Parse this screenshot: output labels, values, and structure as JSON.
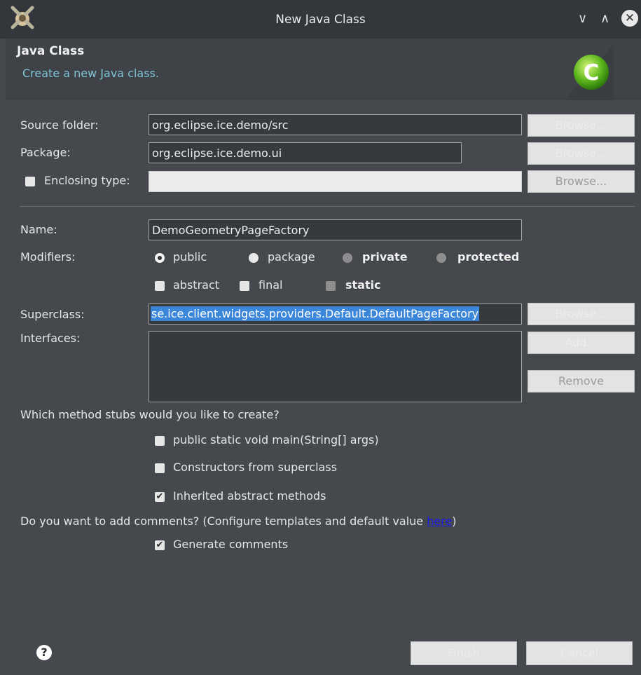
{
  "window": {
    "title": "New Java Class",
    "minimize_glyph": "∨",
    "maximize_glyph": "∧",
    "close_glyph": "✕",
    "accent": "#4a90d9"
  },
  "header": {
    "title": "Java Class",
    "subtitle": "Create a new Java class.",
    "badge_letter": "C"
  },
  "form": {
    "source_folder": {
      "label": "Source folder:",
      "value": "org.eclipse.ice.demo/src",
      "button": "Browse..."
    },
    "package": {
      "label": "Package:",
      "value": "org.eclipse.ice.demo.ui",
      "button": "Browse..."
    },
    "enclosing_type": {
      "label": "Enclosing type:",
      "value": "",
      "checked": false,
      "button": "Browse..."
    },
    "name": {
      "label": "Name:",
      "value": "DemoGeometryPageFactory"
    },
    "modifiers": {
      "label": "Modifiers:",
      "access": [
        "public",
        "package",
        "private",
        "protected"
      ],
      "selected": "public",
      "flags": [
        "abstract",
        "final",
        "static"
      ]
    },
    "superclass": {
      "label": "Superclass:",
      "value": "se.ice.client.widgets.providers.Default.DefaultPageFactory",
      "button": "Browse..."
    },
    "interfaces": {
      "label": "Interfaces:",
      "add_button": "Add...",
      "remove_button": "Remove"
    },
    "stubs": {
      "question": "Which method stubs would you like to create?",
      "options": [
        {
          "label": "public static void main(String[] args)",
          "checked": false
        },
        {
          "label": "Constructors from superclass",
          "checked": false
        },
        {
          "label": "Inherited abstract methods",
          "checked": true
        }
      ]
    },
    "comments": {
      "question": "Do you want to add comments? (Configure templates and default value ",
      "link": "here",
      "question_end": ")",
      "option": {
        "label": "Generate comments",
        "checked": true
      }
    }
  },
  "footer": {
    "help": "?",
    "finish": "Finish",
    "cancel": "Cancel"
  }
}
